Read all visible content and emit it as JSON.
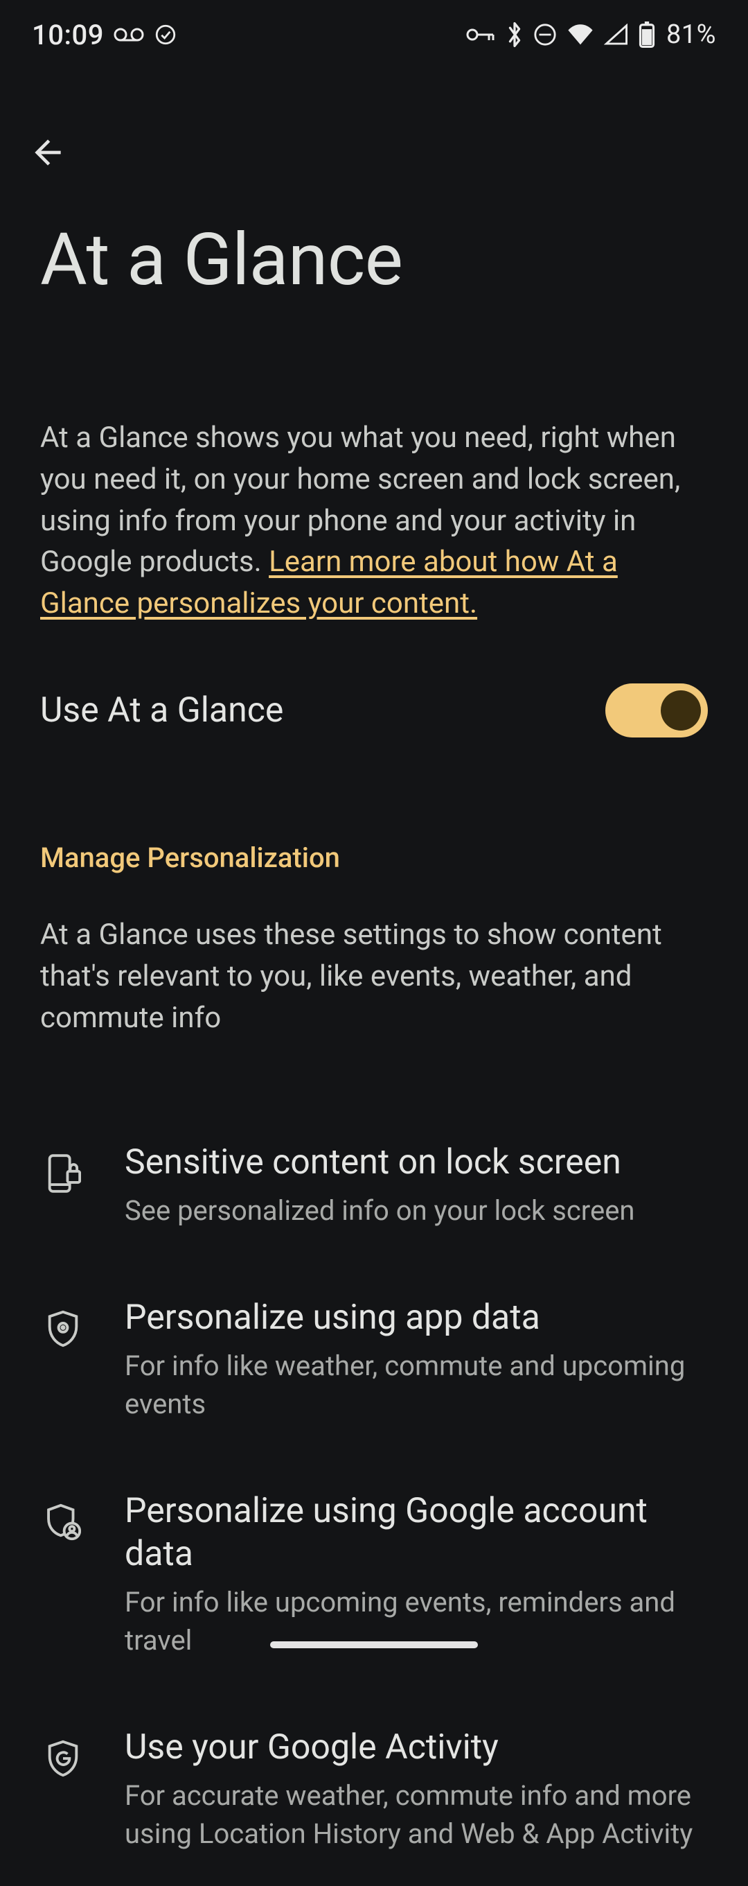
{
  "status": {
    "time": "10:09",
    "battery_pct": "81%"
  },
  "page": {
    "title": "At a Glance",
    "intro_text": "At a Glance shows you what you need, right when you need it, on your home screen and lock screen, using info from your phone and your activity in Google products. ",
    "intro_link": "Learn more about how At a Glance personalizes your content."
  },
  "toggle": {
    "label": "Use At a Glance",
    "on": true
  },
  "section": {
    "header": "Manage Personalization",
    "body": "At a Glance uses these settings to show content that's relevant to you, like events, weather, and commute info"
  },
  "items": [
    {
      "title": "Sensitive content on lock screen",
      "sub": "See personalized info on your lock screen"
    },
    {
      "title": "Personalize using app data",
      "sub": "For info like weather, commute and upcoming events"
    },
    {
      "title": "Personalize using Google account data",
      "sub": "For info like upcoming events, reminders and travel"
    },
    {
      "title": "Use your Google Activity",
      "sub": "For accurate weather, commute info and more using Location History and Web & App Activity"
    }
  ]
}
